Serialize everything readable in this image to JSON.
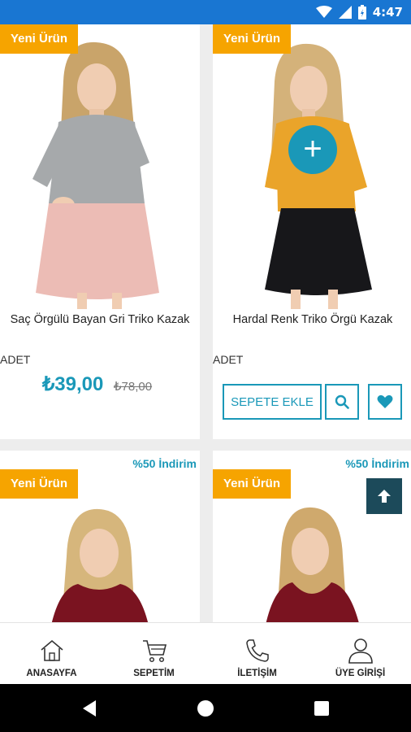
{
  "status": {
    "time": "4:47"
  },
  "products": [
    {
      "badge": "Yeni Ürün",
      "name": "Saç Örgülü Bayan Gri Triko Kazak",
      "unit": "ADET",
      "price": "₺39,00",
      "old_price": "₺78,00"
    },
    {
      "badge": "Yeni Ürün",
      "name": "Hardal Renk Triko Örgü Kazak",
      "unit": "ADET",
      "add_to_cart": "SEPETE EKLE"
    },
    {
      "badge": "Yeni Ürün",
      "discount": "%50 İndirim"
    },
    {
      "badge": "Yeni Ürün",
      "discount": "%50 İndirim"
    }
  ],
  "nav": [
    {
      "label": "ANASAYFA",
      "icon": "home-icon"
    },
    {
      "label": "SEPETİM",
      "icon": "cart-icon"
    },
    {
      "label": "İLETİŞİM",
      "icon": "phone-icon"
    },
    {
      "label": "ÜYE GİRİŞİ",
      "icon": "user-icon"
    }
  ],
  "colors": {
    "accent": "#1a98b8",
    "badge": "#f6a400",
    "statusbar": "#1976d2",
    "scroll_top": "#1c4a5a"
  }
}
